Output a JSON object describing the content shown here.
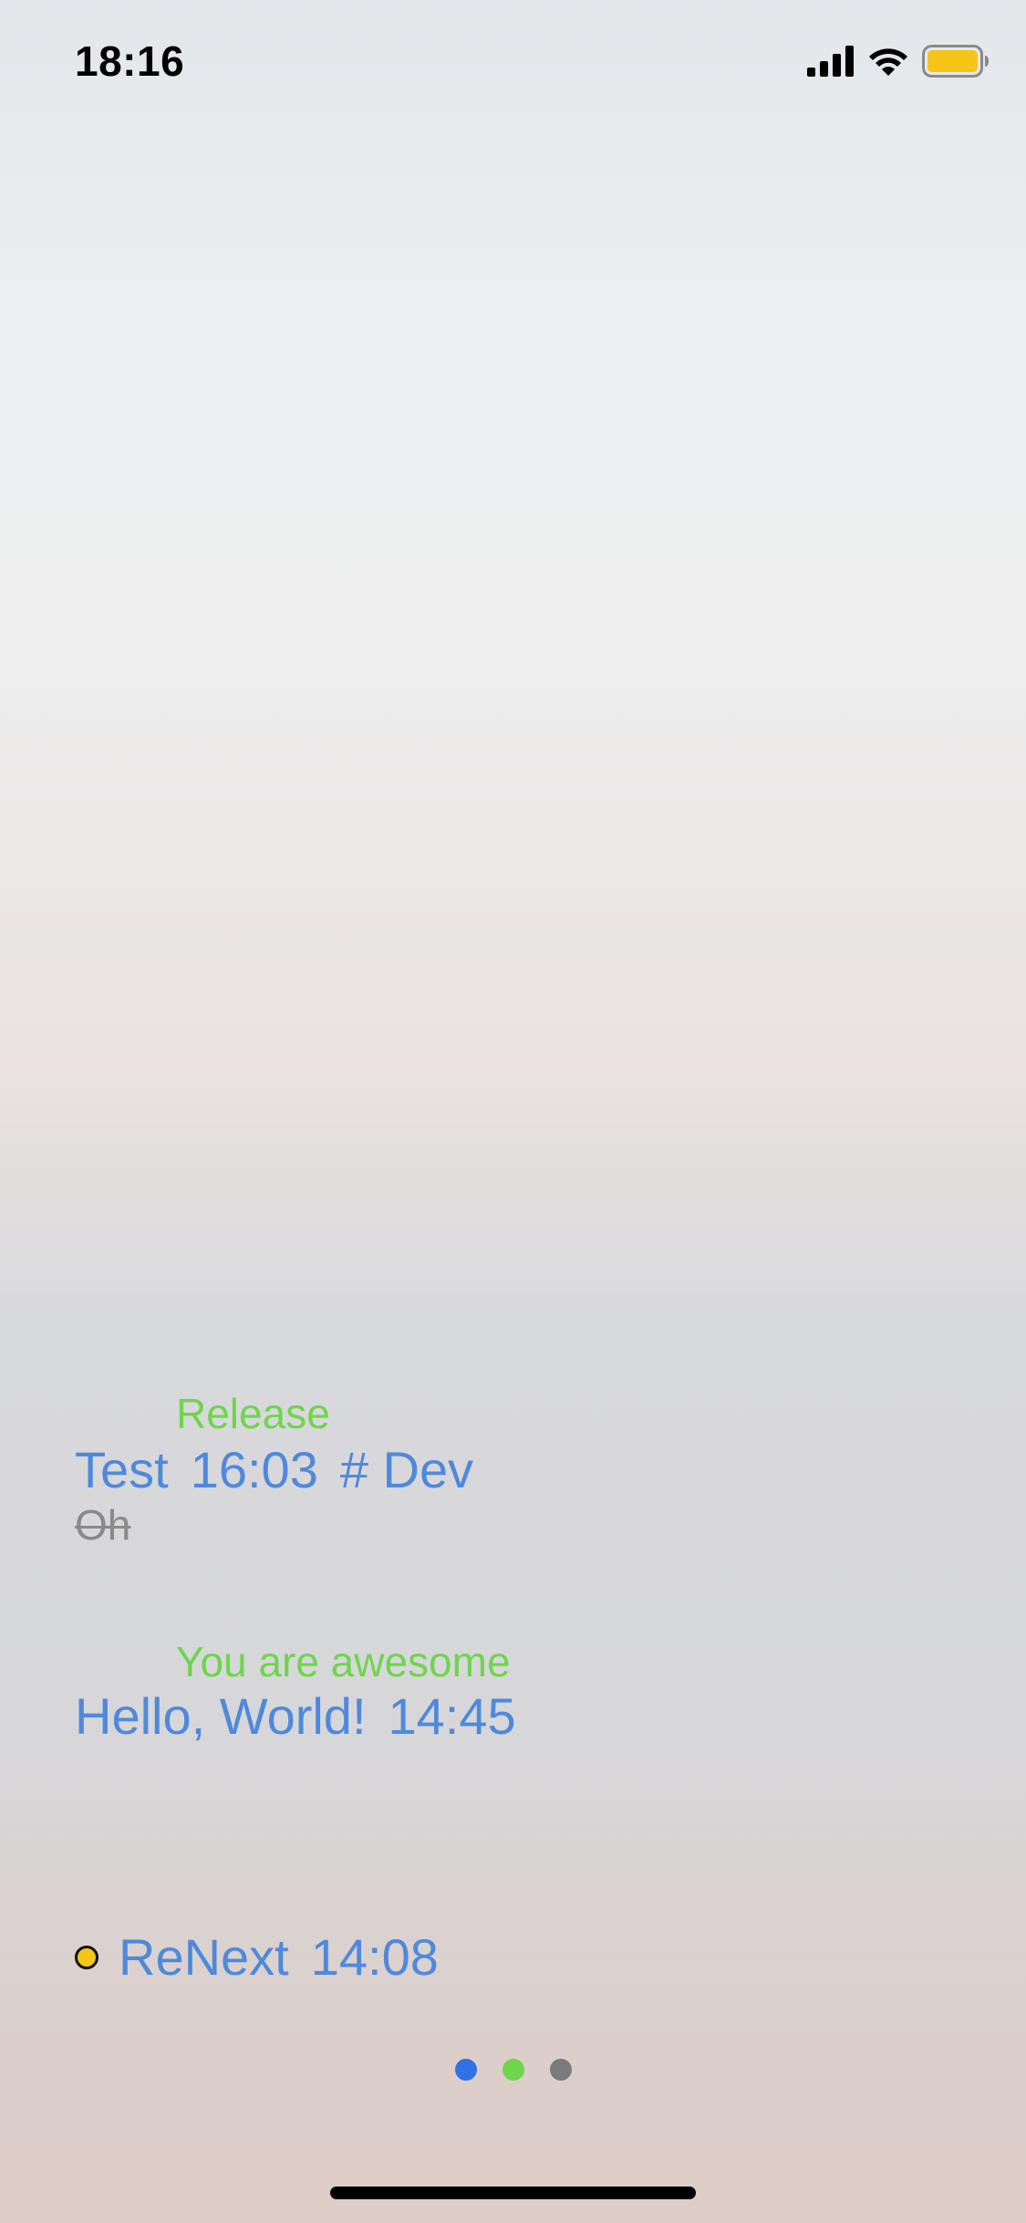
{
  "status_bar": {
    "time": "18:16",
    "icons": [
      "cellular-signal-icon",
      "wifi-icon",
      "battery-icon"
    ],
    "battery_color": "#f5c518"
  },
  "tasks": [
    {
      "tag": "Release",
      "title": "Test",
      "time": "16:03",
      "category": "# Dev",
      "subtask_done": "Oh",
      "color": "#4f89da"
    },
    {
      "tag": "You are awesome",
      "title": "Hello, World!",
      "time": "14:45",
      "color": "#4f89da"
    },
    {
      "title": "ReNext",
      "time": "14:08",
      "status_dot_color": "#f5c518"
    }
  ],
  "page_indicator": {
    "dots": [
      "#2f72e8",
      "#6fd54c",
      "#7b7b7b"
    ]
  },
  "tag_color": "#6fd54c"
}
